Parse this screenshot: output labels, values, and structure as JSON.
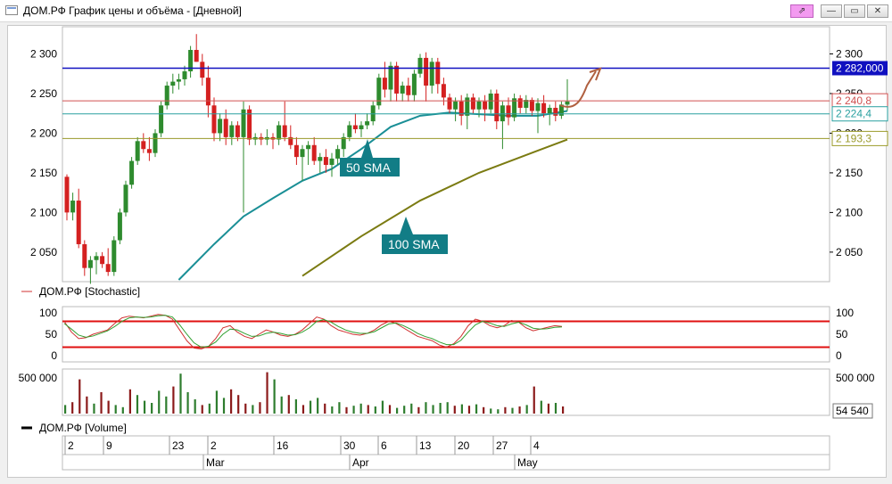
{
  "window": {
    "title": "ДОМ.РФ График цены и объёма - [Дневной]",
    "buttons": {
      "link": "⇗",
      "minimize": "—",
      "maximize": "▭",
      "close": "✕"
    }
  },
  "colors": {
    "bull": "#2e8b2e",
    "bear": "#d42020",
    "sma50": "#1a8f96",
    "sma100": "#7b7b12",
    "blue_line": "#1010c0",
    "red_level": "#d05050",
    "teal_level": "#2aa0a0",
    "olive_level": "#9a9a2a",
    "vol_up": "#2e7d2e",
    "vol_down": "#8b1a1a",
    "stoch_band": "#e01010",
    "stoch_k": "#d03030",
    "stoch_d": "#30a030",
    "arrow": "#b06040"
  },
  "chart_data": [
    {
      "type": "candlestick",
      "title": "",
      "y_ticks": [
        "2 300",
        "2 250",
        "2 200",
        "2 150",
        "2 100",
        "2 050"
      ],
      "y_tick_values": [
        2300,
        2250,
        2200,
        2150,
        2100,
        2050
      ],
      "ylim": [
        2015,
        2332
      ],
      "price_labels": [
        {
          "text": "2 282,000",
          "value": 2282,
          "style": "blue"
        },
        {
          "text": "2 240,8",
          "value": 2240.8,
          "style": "red"
        },
        {
          "text": "2 224,4",
          "value": 2224.4,
          "style": "teal"
        },
        {
          "text": "2 193,3",
          "value": 2193.3,
          "style": "olive"
        }
      ],
      "annotations": [
        "50 SMA",
        "100 SMA"
      ],
      "candles": [
        [
          2145,
          2148,
          2090,
          2100
        ],
        [
          2100,
          2125,
          2090,
          2115
        ],
        [
          2115,
          2130,
          2055,
          2060
        ],
        [
          2060,
          2065,
          2020,
          2030
        ],
        [
          2030,
          2045,
          2010,
          2040
        ],
        [
          2040,
          2050,
          2022,
          2045
        ],
        [
          2045,
          2050,
          2030,
          2035
        ],
        [
          2035,
          2055,
          2020,
          2025
        ],
        [
          2025,
          2070,
          2020,
          2065
        ],
        [
          2065,
          2105,
          2060,
          2100
        ],
        [
          2100,
          2140,
          2095,
          2135
        ],
        [
          2135,
          2170,
          2130,
          2165
        ],
        [
          2165,
          2195,
          2160,
          2190
        ],
        [
          2190,
          2200,
          2175,
          2180
        ],
        [
          2180,
          2195,
          2165,
          2175
        ],
        [
          2175,
          2205,
          2170,
          2200
        ],
        [
          2200,
          2240,
          2195,
          2235
        ],
        [
          2235,
          2265,
          2230,
          2260
        ],
        [
          2260,
          2275,
          2250,
          2265
        ],
        [
          2265,
          2275,
          2255,
          2268
        ],
        [
          2268,
          2285,
          2260,
          2278
        ],
        [
          2278,
          2310,
          2270,
          2305
        ],
        [
          2305,
          2325,
          2290,
          2290
        ],
        [
          2290,
          2300,
          2260,
          2270
        ],
        [
          2270,
          2285,
          2220,
          2235
        ],
        [
          2235,
          2245,
          2190,
          2200
        ],
        [
          2200,
          2225,
          2190,
          2218
        ],
        [
          2218,
          2230,
          2185,
          2195
        ],
        [
          2195,
          2215,
          2185,
          2210
        ],
        [
          2210,
          2215,
          2190,
          2195
        ],
        [
          2195,
          2240,
          2100,
          2230
        ],
        [
          2230,
          2235,
          2185,
          2192
        ],
        [
          2192,
          2200,
          2185,
          2195
        ],
        [
          2195,
          2200,
          2185,
          2192
        ],
        [
          2192,
          2205,
          2185,
          2195
        ],
        [
          2195,
          2200,
          2180,
          2192
        ],
        [
          2192,
          2215,
          2185,
          2210
        ],
        [
          2210,
          2240,
          2190,
          2195
        ],
        [
          2195,
          2210,
          2180,
          2185
        ],
        [
          2185,
          2195,
          2160,
          2170
        ],
        [
          2170,
          2185,
          2140,
          2180
        ],
        [
          2180,
          2190,
          2160,
          2185
        ],
        [
          2185,
          2195,
          2160,
          2165
        ],
        [
          2165,
          2175,
          2150,
          2170
        ],
        [
          2170,
          2180,
          2150,
          2160
        ],
        [
          2160,
          2175,
          2145,
          2168
        ],
        [
          2168,
          2185,
          2160,
          2180
        ],
        [
          2180,
          2200,
          2170,
          2195
        ],
        [
          2195,
          2215,
          2190,
          2210
        ],
        [
          2210,
          2225,
          2200,
          2205
        ],
        [
          2205,
          2215,
          2195,
          2210
        ],
        [
          2210,
          2225,
          2205,
          2215
        ],
        [
          2215,
          2240,
          2210,
          2235
        ],
        [
          2235,
          2275,
          2230,
          2270
        ],
        [
          2270,
          2290,
          2245,
          2255
        ],
        [
          2255,
          2290,
          2240,
          2285
        ],
        [
          2285,
          2290,
          2240,
          2250
        ],
        [
          2250,
          2265,
          2240,
          2260
        ],
        [
          2260,
          2270,
          2240,
          2248
        ],
        [
          2248,
          2280,
          2240,
          2275
        ],
        [
          2275,
          2300,
          2270,
          2295
        ],
        [
          2295,
          2302,
          2240,
          2260
        ],
        [
          2260,
          2295,
          2250,
          2290
        ],
        [
          2290,
          2295,
          2250,
          2262
        ],
        [
          2262,
          2270,
          2235,
          2245
        ],
        [
          2245,
          2250,
          2225,
          2230
        ],
        [
          2230,
          2245,
          2215,
          2240
        ],
        [
          2240,
          2248,
          2210,
          2222
        ],
        [
          2222,
          2250,
          2205,
          2245
        ],
        [
          2245,
          2250,
          2225,
          2230
        ],
        [
          2230,
          2245,
          2220,
          2240
        ],
        [
          2240,
          2248,
          2215,
          2230
        ],
        [
          2230,
          2255,
          2225,
          2250
        ],
        [
          2250,
          2255,
          2205,
          2215
        ],
        [
          2215,
          2240,
          2180,
          2235
        ],
        [
          2235,
          2245,
          2210,
          2220
        ],
        [
          2220,
          2250,
          2215,
          2244
        ],
        [
          2244,
          2248,
          2225,
          2232
        ],
        [
          2232,
          2248,
          2225,
          2242
        ],
        [
          2242,
          2245,
          2222,
          2228
        ],
        [
          2228,
          2244,
          2200,
          2238
        ],
        [
          2238,
          2248,
          2220,
          2225
        ],
        [
          2225,
          2236,
          2210,
          2232
        ],
        [
          2232,
          2240,
          2215,
          2222
        ],
        [
          2222,
          2240,
          2218,
          2236
        ],
        [
          2236,
          2268,
          2228,
          2240
        ]
      ],
      "sma50": [
        [
          0,
          null
        ],
        [
          19,
          2015
        ],
        [
          25,
          2060
        ],
        [
          30,
          2095
        ],
        [
          35,
          2118
        ],
        [
          40,
          2140
        ],
        [
          45,
          2155
        ],
        [
          50,
          2180
        ],
        [
          55,
          2208
        ],
        [
          60,
          2222
        ],
        [
          65,
          2226
        ],
        [
          70,
          2224
        ],
        [
          75,
          2222
        ],
        [
          80,
          2222
        ],
        [
          85,
          2228
        ]
      ],
      "sma100": [
        [
          40,
          2020
        ],
        [
          50,
          2070
        ],
        [
          60,
          2115
        ],
        [
          70,
          2150
        ],
        [
          80,
          2178
        ],
        [
          85,
          2192
        ]
      ]
    },
    {
      "type": "line",
      "title": "",
      "legend": "ДОМ.РФ [Stochastic]",
      "y_ticks": [
        "100",
        "50",
        "0"
      ],
      "y_tick_values": [
        100,
        50,
        0
      ],
      "ylim": [
        -10,
        110
      ],
      "bands": [
        80,
        20
      ],
      "series": [
        {
          "values": [
            80,
            55,
            40,
            42,
            50,
            55,
            60,
            75,
            88,
            92,
            90,
            88,
            92,
            96,
            94,
            85,
            60,
            35,
            18,
            16,
            22,
            40,
            65,
            70,
            55,
            45,
            40,
            50,
            60,
            55,
            48,
            45,
            50,
            60,
            75,
            90,
            85,
            70,
            60,
            55,
            50,
            48,
            52,
            60,
            72,
            80,
            75,
            65,
            55,
            45,
            40,
            35,
            25,
            20,
            28,
            45,
            70,
            85,
            80,
            70,
            65,
            70,
            82,
            78,
            65,
            58,
            62,
            66,
            70,
            68
          ]
        },
        {
          "values": [
            75,
            62,
            48,
            43,
            46,
            52,
            58,
            68,
            80,
            88,
            90,
            89,
            90,
            93,
            94,
            90,
            72,
            50,
            30,
            20,
            22,
            32,
            50,
            62,
            60,
            52,
            45,
            46,
            52,
            55,
            52,
            48,
            49,
            55,
            65,
            80,
            84,
            78,
            68,
            60,
            55,
            52,
            52,
            56,
            65,
            74,
            76,
            70,
            62,
            52,
            45,
            40,
            32,
            26,
            26,
            36,
            55,
            72,
            80,
            76,
            70,
            68,
            74,
            78,
            72,
            64,
            62,
            63,
            66,
            67
          ]
        }
      ]
    },
    {
      "type": "bar",
      "title": "",
      "legend": "ДОМ.РФ [Volume]",
      "y_ticks": [
        "500 000"
      ],
      "y_tick_values": [
        500000
      ],
      "last_volume_label": "54 540",
      "ylim": [
        0,
        600000
      ],
      "values": [
        120000,
        160000,
        480000,
        240000,
        140000,
        300000,
        180000,
        120000,
        90000,
        340000,
        260000,
        180000,
        150000,
        320000,
        240000,
        380000,
        560000,
        300000,
        200000,
        120000,
        140000,
        320000,
        220000,
        340000,
        260000,
        140000,
        120000,
        160000,
        580000,
        480000,
        240000,
        260000,
        200000,
        120000,
        180000,
        220000,
        140000,
        100000,
        160000,
        90000,
        110000,
        140000,
        120000,
        100000,
        180000,
        120000,
        80000,
        110000,
        140000,
        90000,
        160000,
        120000,
        150000,
        160000,
        110000,
        130000,
        110000,
        130000,
        90000,
        70000,
        60000,
        90000,
        80000,
        100000,
        120000,
        380000,
        180000,
        140000,
        150000,
        100000
      ],
      "up": [
        1,
        0,
        0,
        0,
        1,
        0,
        0,
        1,
        1,
        0,
        1,
        1,
        1,
        1,
        1,
        0,
        1,
        1,
        1,
        0,
        1,
        1,
        1,
        0,
        0,
        0,
        1,
        0,
        0,
        1,
        1,
        0,
        1,
        0,
        1,
        1,
        0,
        1,
        1,
        0,
        1,
        1,
        0,
        1,
        1,
        0,
        1,
        1,
        1,
        0,
        1,
        1,
        1,
        1,
        0,
        1,
        0,
        1,
        0,
        1,
        1,
        0,
        1,
        0,
        1,
        0,
        1,
        0,
        1,
        0
      ]
    }
  ],
  "date_axis": {
    "day_ticks": [
      "2",
      "9",
      "23",
      "2",
      "16",
      "30",
      "6",
      "13",
      "20",
      "27",
      "4"
    ],
    "months": [
      "Mar",
      "Apr",
      "May"
    ]
  }
}
